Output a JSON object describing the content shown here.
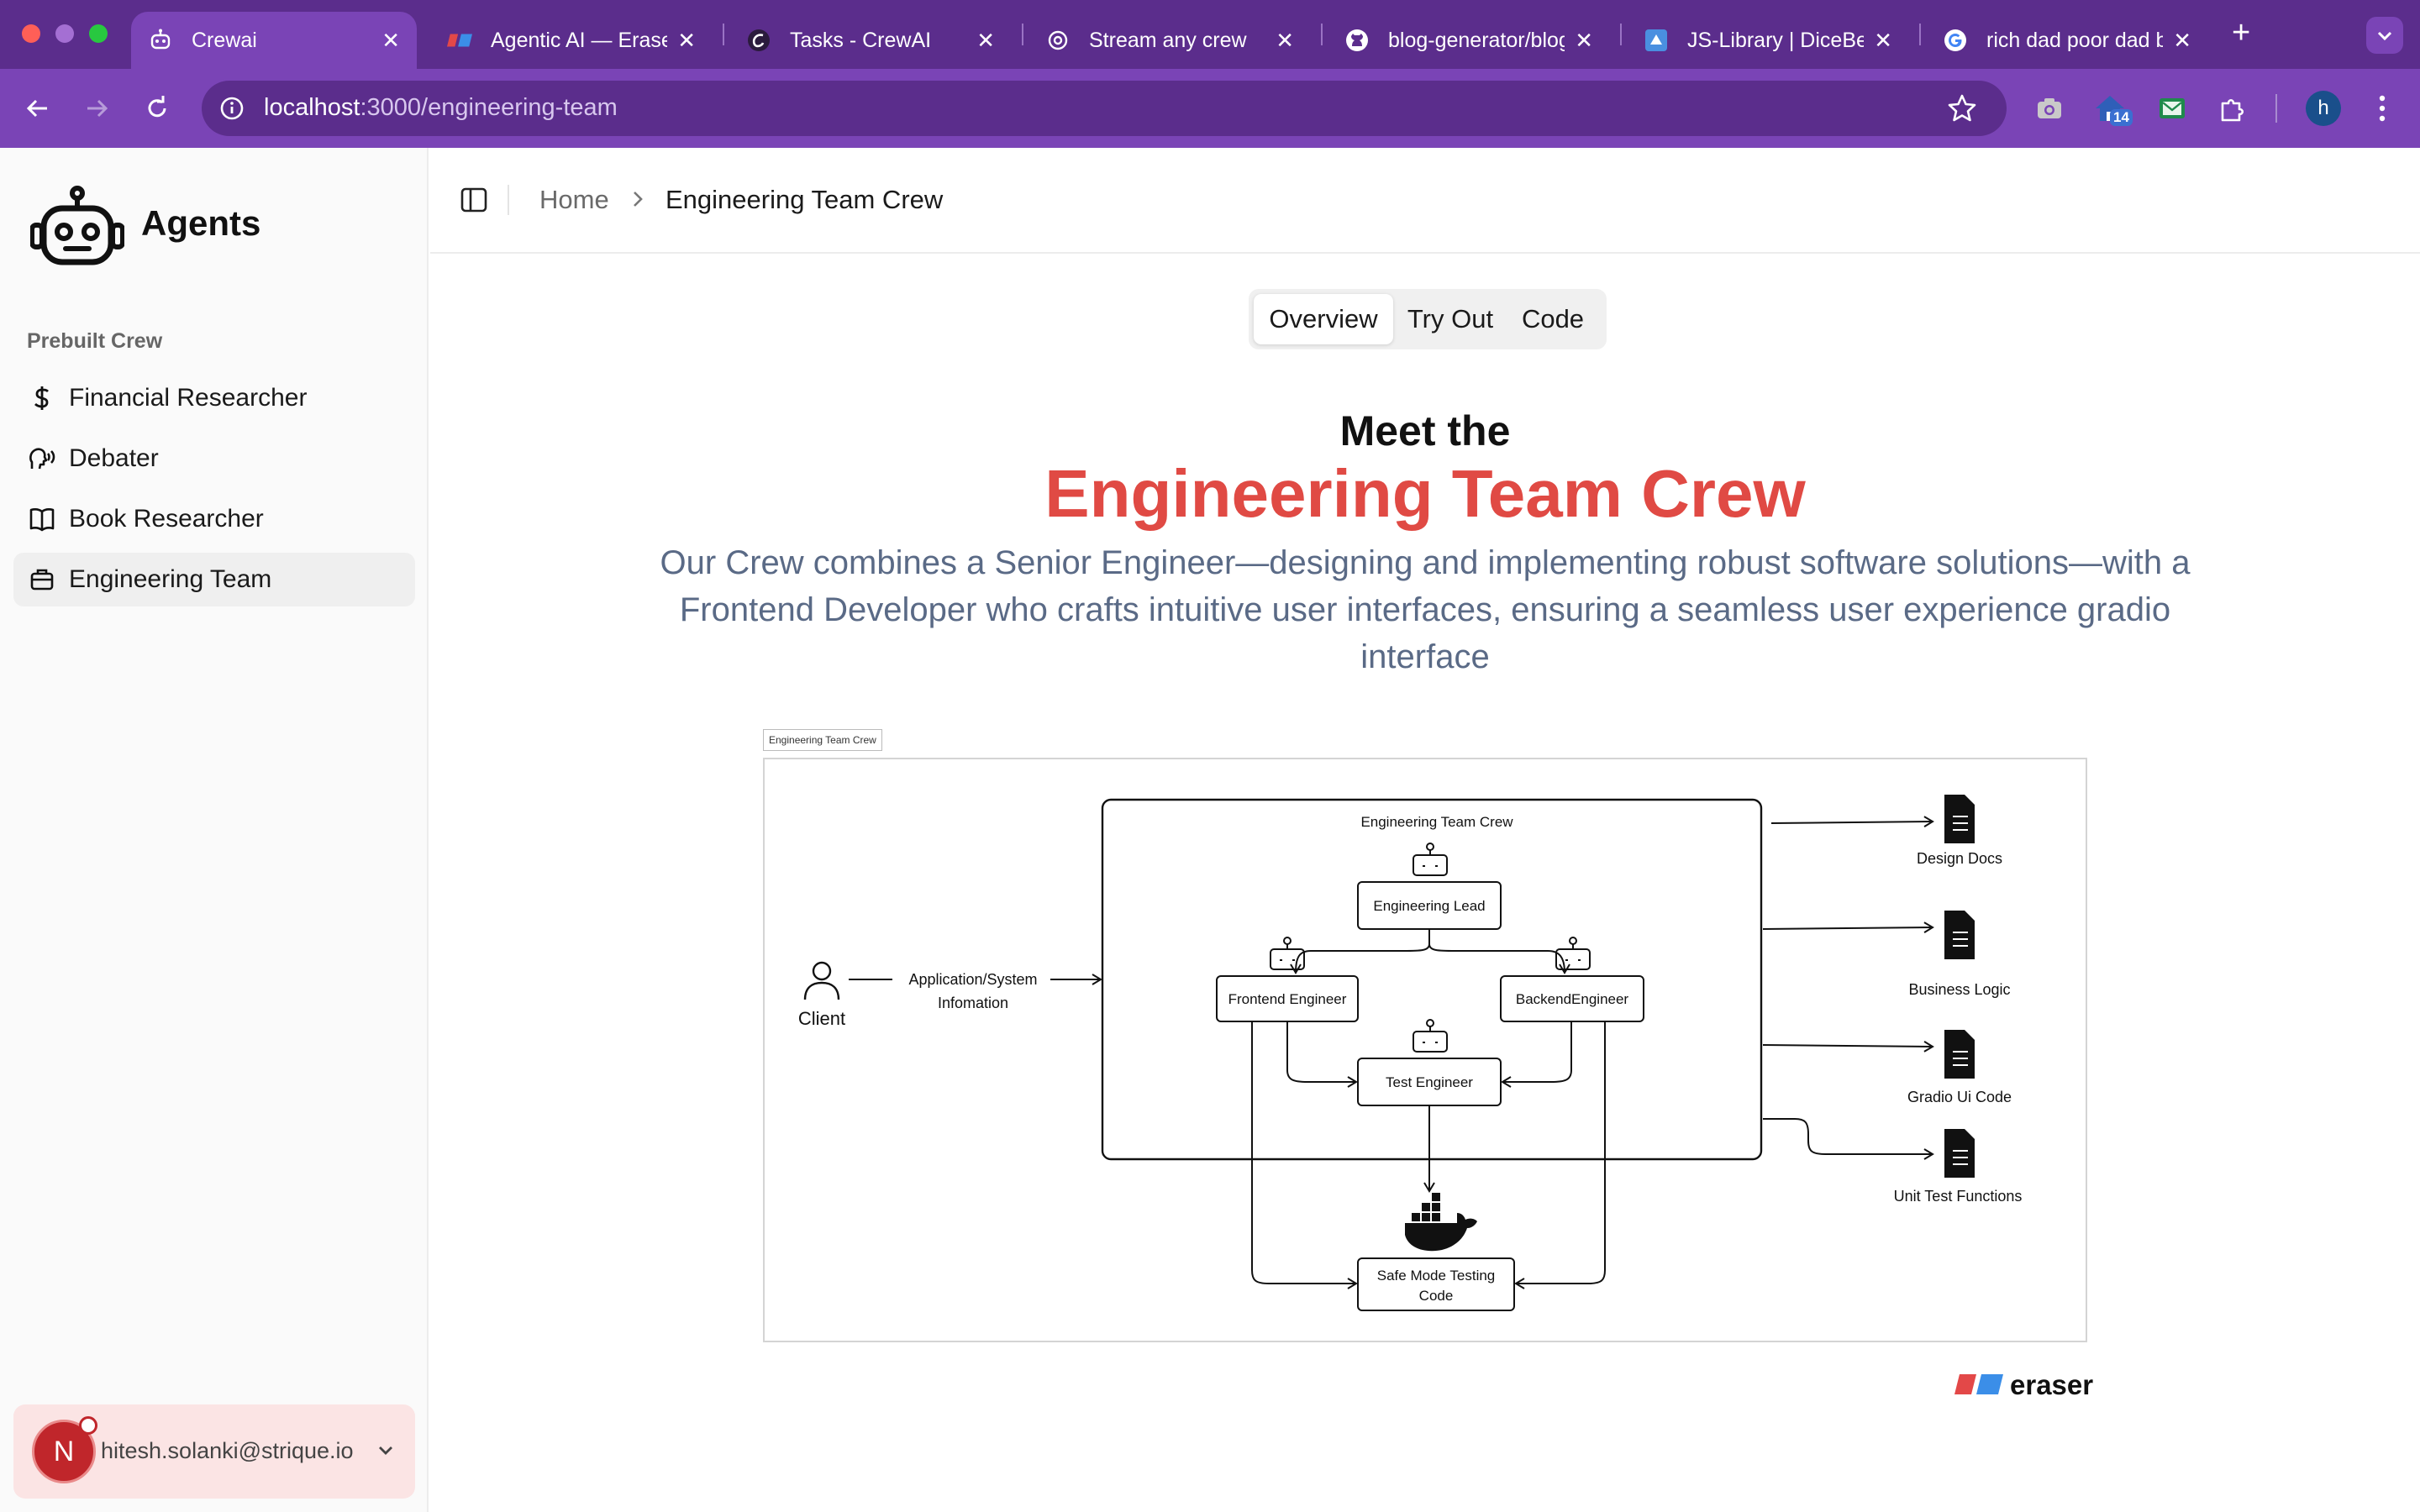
{
  "browser": {
    "tabs": [
      {
        "title": "Crewai",
        "favicon": "crewai-robot-icon"
      },
      {
        "title": "Agentic AI — Eraser",
        "favicon": "eraser-icon"
      },
      {
        "title": "Tasks - CrewAI",
        "favicon": "crewai-icon"
      },
      {
        "title": "Stream any crew",
        "favicon": "openai-icon"
      },
      {
        "title": "blog-generator/blog",
        "favicon": "github-icon"
      },
      {
        "title": "JS-Library | DiceBear",
        "favicon": "dicebear-icon"
      },
      {
        "title": "rich dad poor dad book",
        "favicon": "google-icon"
      }
    ],
    "address": {
      "host": "localhost",
      "path": ":3000/engineering-team"
    },
    "extension_badge": "14",
    "profile_initial": "h"
  },
  "sidebar": {
    "brand": "Agents",
    "section_label": "Prebuilt Crew",
    "items": [
      {
        "label": "Financial Researcher",
        "icon": "dollar-icon"
      },
      {
        "label": "Debater",
        "icon": "speaking-head-icon"
      },
      {
        "label": "Book Researcher",
        "icon": "book-open-icon"
      },
      {
        "label": "Engineering Team",
        "icon": "briefcase-icon"
      }
    ],
    "user": {
      "initial": "N",
      "email": "hitesh.solanki@strique.io"
    }
  },
  "breadcrumb": {
    "home": "Home",
    "current": "Engineering Team Crew"
  },
  "tabs": {
    "overview": "Overview",
    "try_out": "Try Out",
    "code": "Code",
    "active": "Overview"
  },
  "hero": {
    "line1": "Meet the",
    "line2": "Engineering Team Crew",
    "description": "Our Crew combines a Senior Engineer—designing and implementing robust software solutions—with a Frontend Developer who crafts intuitive user interfaces, ensuring a seamless user experience gradio interface"
  },
  "diagram": {
    "tag": "Engineering Team Crew",
    "group_title": "Engineering Team Crew",
    "client": "Client",
    "input_label_1": "Application/System",
    "input_label_2": "Infomation",
    "nodes": {
      "lead": "Engineering Lead",
      "frontend": "Frontend Engineer",
      "backend": "BackendEngineer",
      "test": "Test Engineer",
      "safe_1": "Safe Mode Testing",
      "safe_2": "Code"
    },
    "outputs": [
      "Design Docs",
      "Business Logic",
      "Gradio Ui Code",
      "Unit Test Functions"
    ]
  },
  "footer_brand": "eraser",
  "colors": {
    "accent": "#e04a44",
    "chrome": "#7a44b6",
    "chrome_dark": "#5b2d8c",
    "avatar": "#c0262b"
  }
}
